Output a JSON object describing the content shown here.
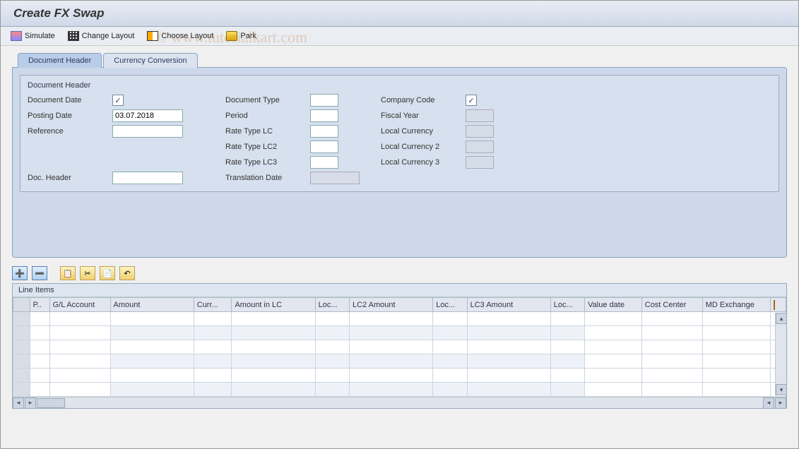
{
  "header": {
    "title": "Create FX Swap"
  },
  "watermark": "© www.tutorialkart.com",
  "toolbar": {
    "simulate": "Simulate",
    "change_layout": "Change Layout",
    "choose_layout": "Choose Layout",
    "park": "Park"
  },
  "tabs": {
    "document_header": "Document Header",
    "currency_conversion": "Currency Conversion"
  },
  "form": {
    "legend": "Document Header",
    "labels": {
      "document_date": "Document Date",
      "posting_date": "Posting Date",
      "reference": "Reference",
      "doc_header": "Doc. Header",
      "document_type": "Document Type",
      "period": "Period",
      "rate_type_lc": "Rate Type LC",
      "rate_type_lc2": "Rate Type LC2",
      "rate_type_lc3": "Rate Type LC3",
      "translation_date": "Translation Date",
      "company_code": "Company Code",
      "fiscal_year": "Fiscal Year",
      "local_currency": "Local Currency",
      "local_currency2": "Local Currency 2",
      "local_currency3": "Local Currency 3"
    },
    "values": {
      "document_date": "",
      "posting_date": "03.07.2018",
      "reference": "",
      "doc_header": "",
      "document_type": "",
      "period": "",
      "rate_type_lc": "",
      "rate_type_lc2": "",
      "rate_type_lc3": "",
      "translation_date": "",
      "company_code": "",
      "fiscal_year": "",
      "local_currency": "",
      "local_currency2": "",
      "local_currency3": ""
    }
  },
  "grid": {
    "title": "Line Items",
    "columns": [
      "",
      "P..",
      "G/L Account",
      "Amount",
      "Curr...",
      "Amount in LC",
      "Loc...",
      "LC2 Amount",
      "Loc...",
      "LC3 Amount",
      "Loc...",
      "Value date",
      "Cost Center",
      "MD Exchange"
    ],
    "rows": 6
  }
}
